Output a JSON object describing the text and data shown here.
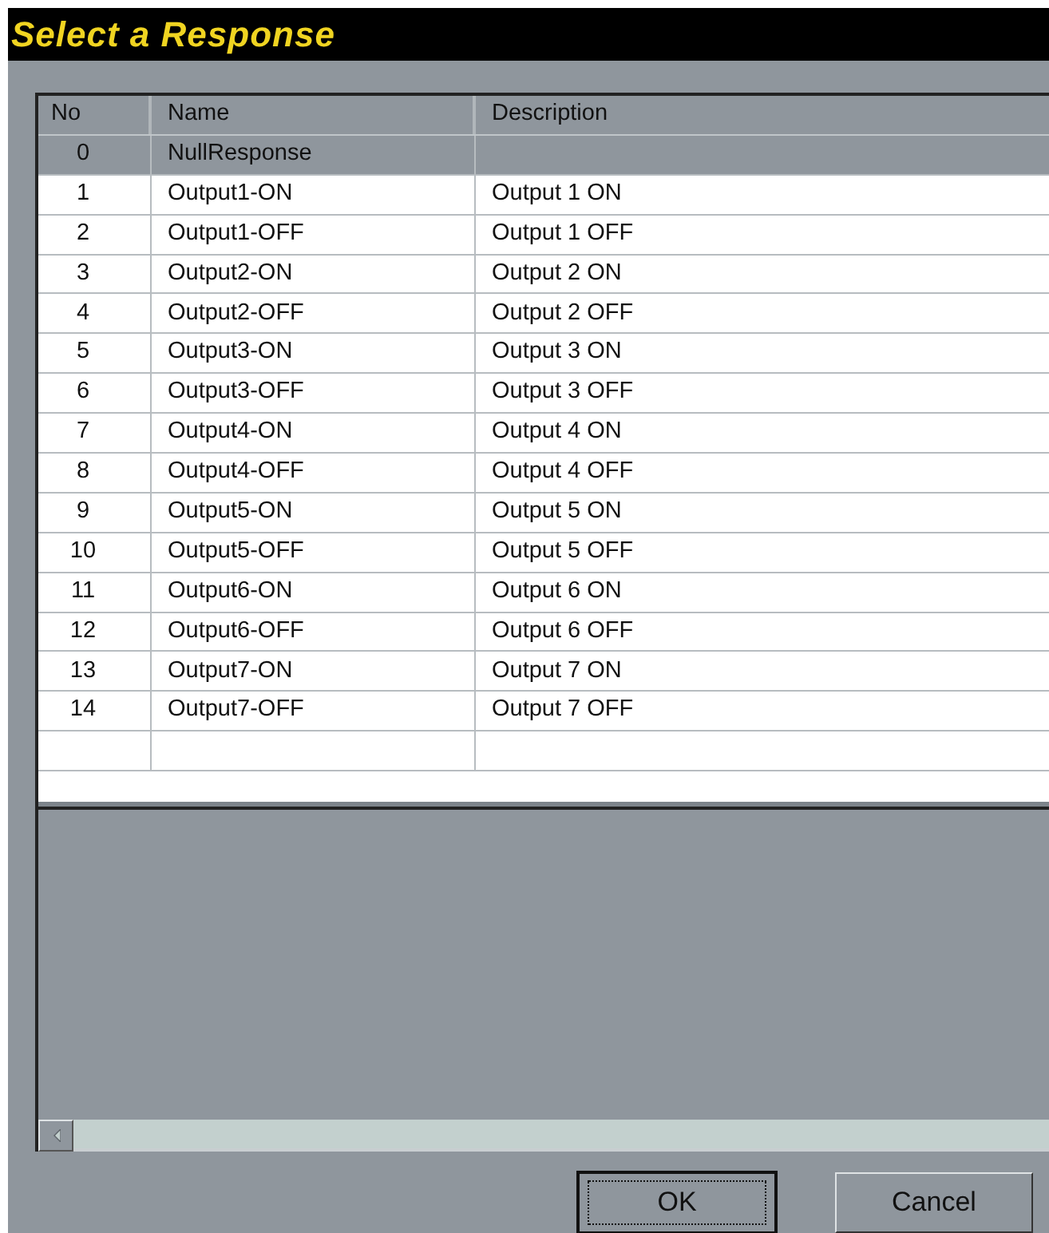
{
  "window": {
    "title": "Select a Response"
  },
  "table": {
    "columns": [
      "No",
      "Name",
      "Description"
    ],
    "rows": [
      {
        "no": "0",
        "name": "NullResponse",
        "description": "",
        "selected": true
      },
      {
        "no": "1",
        "name": "Output1-ON",
        "description": "Output 1 ON",
        "selected": false
      },
      {
        "no": "2",
        "name": "Output1-OFF",
        "description": "Output 1 OFF",
        "selected": false
      },
      {
        "no": "3",
        "name": "Output2-ON",
        "description": "Output 2 ON",
        "selected": false
      },
      {
        "no": "4",
        "name": "Output2-OFF",
        "description": "Output 2 OFF",
        "selected": false
      },
      {
        "no": "5",
        "name": "Output3-ON",
        "description": "Output 3 ON",
        "selected": false
      },
      {
        "no": "6",
        "name": "Output3-OFF",
        "description": "Output 3 OFF",
        "selected": false
      },
      {
        "no": "7",
        "name": "Output4-ON",
        "description": "Output 4 ON",
        "selected": false
      },
      {
        "no": "8",
        "name": "Output4-OFF",
        "description": "Output 4 OFF",
        "selected": false
      },
      {
        "no": "9",
        "name": "Output5-ON",
        "description": "Output 5 ON",
        "selected": false
      },
      {
        "no": "10",
        "name": "Output5-OFF",
        "description": "Output 5 OFF",
        "selected": false
      },
      {
        "no": "11",
        "name": "Output6-ON",
        "description": "Output 6 ON",
        "selected": false
      },
      {
        "no": "12",
        "name": "Output6-OFF",
        "description": "Output 6 OFF",
        "selected": false
      },
      {
        "no": "13",
        "name": "Output7-ON",
        "description": "Output 7 ON",
        "selected": false
      },
      {
        "no": "14",
        "name": "Output7-OFF",
        "description": "Output 7 OFF",
        "selected": false
      }
    ]
  },
  "buttons": [
    {
      "label": "OK",
      "default": true
    },
    {
      "label": "Cancel",
      "default": false
    }
  ]
}
